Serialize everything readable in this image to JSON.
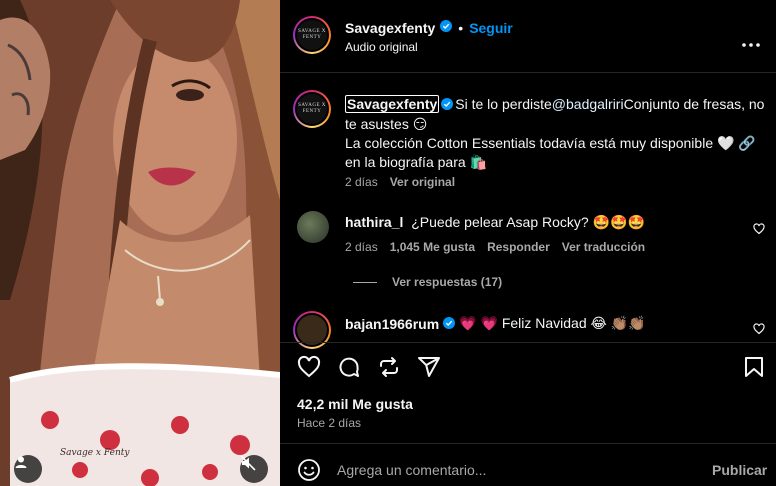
{
  "header": {
    "username": "Savagexfenty",
    "separator": "•",
    "follow_label": "Seguir",
    "subtitle": "Audio original",
    "more_icon": "more-horizontal-icon",
    "avatar_logo": "SAVAGE X FENTY"
  },
  "caption": {
    "username": "Savagexfenty",
    "text_1": "Si te lo perdiste",
    "mention": "@badgalriri",
    "text_2": "Conjunto de fresas, no te asustes 😏",
    "line_2": "La colección Cotton Essentials todavía está muy disponible 🤍 🔗 en la biografía para 🛍️",
    "time": "2 días",
    "translate": "Ver original"
  },
  "comments": [
    {
      "username": "hathira_l",
      "text": "¿Puede pelear Asap Rocky? 🤩🤩🤩",
      "time": "2 días",
      "likes": "1,045 Me gusta",
      "reply": "Responder",
      "translate": "Ver traducción",
      "replies": "Ver respuestas (17)"
    },
    {
      "username": "bajan1966rum",
      "text": "💗 💗  Feliz Navidad 😂 👏🏽👏🏽"
    }
  ],
  "actions": {
    "likes": "42,2 mil Me gusta",
    "date": "Hace 2 días"
  },
  "composer": {
    "placeholder": "Agrega un comentario...",
    "post_label": "Publicar"
  },
  "media": {
    "print_text": "Savage x Fenty"
  },
  "colors": {
    "background": "#000000",
    "accent": "#0095f6",
    "muted": "#a8a8a8"
  }
}
